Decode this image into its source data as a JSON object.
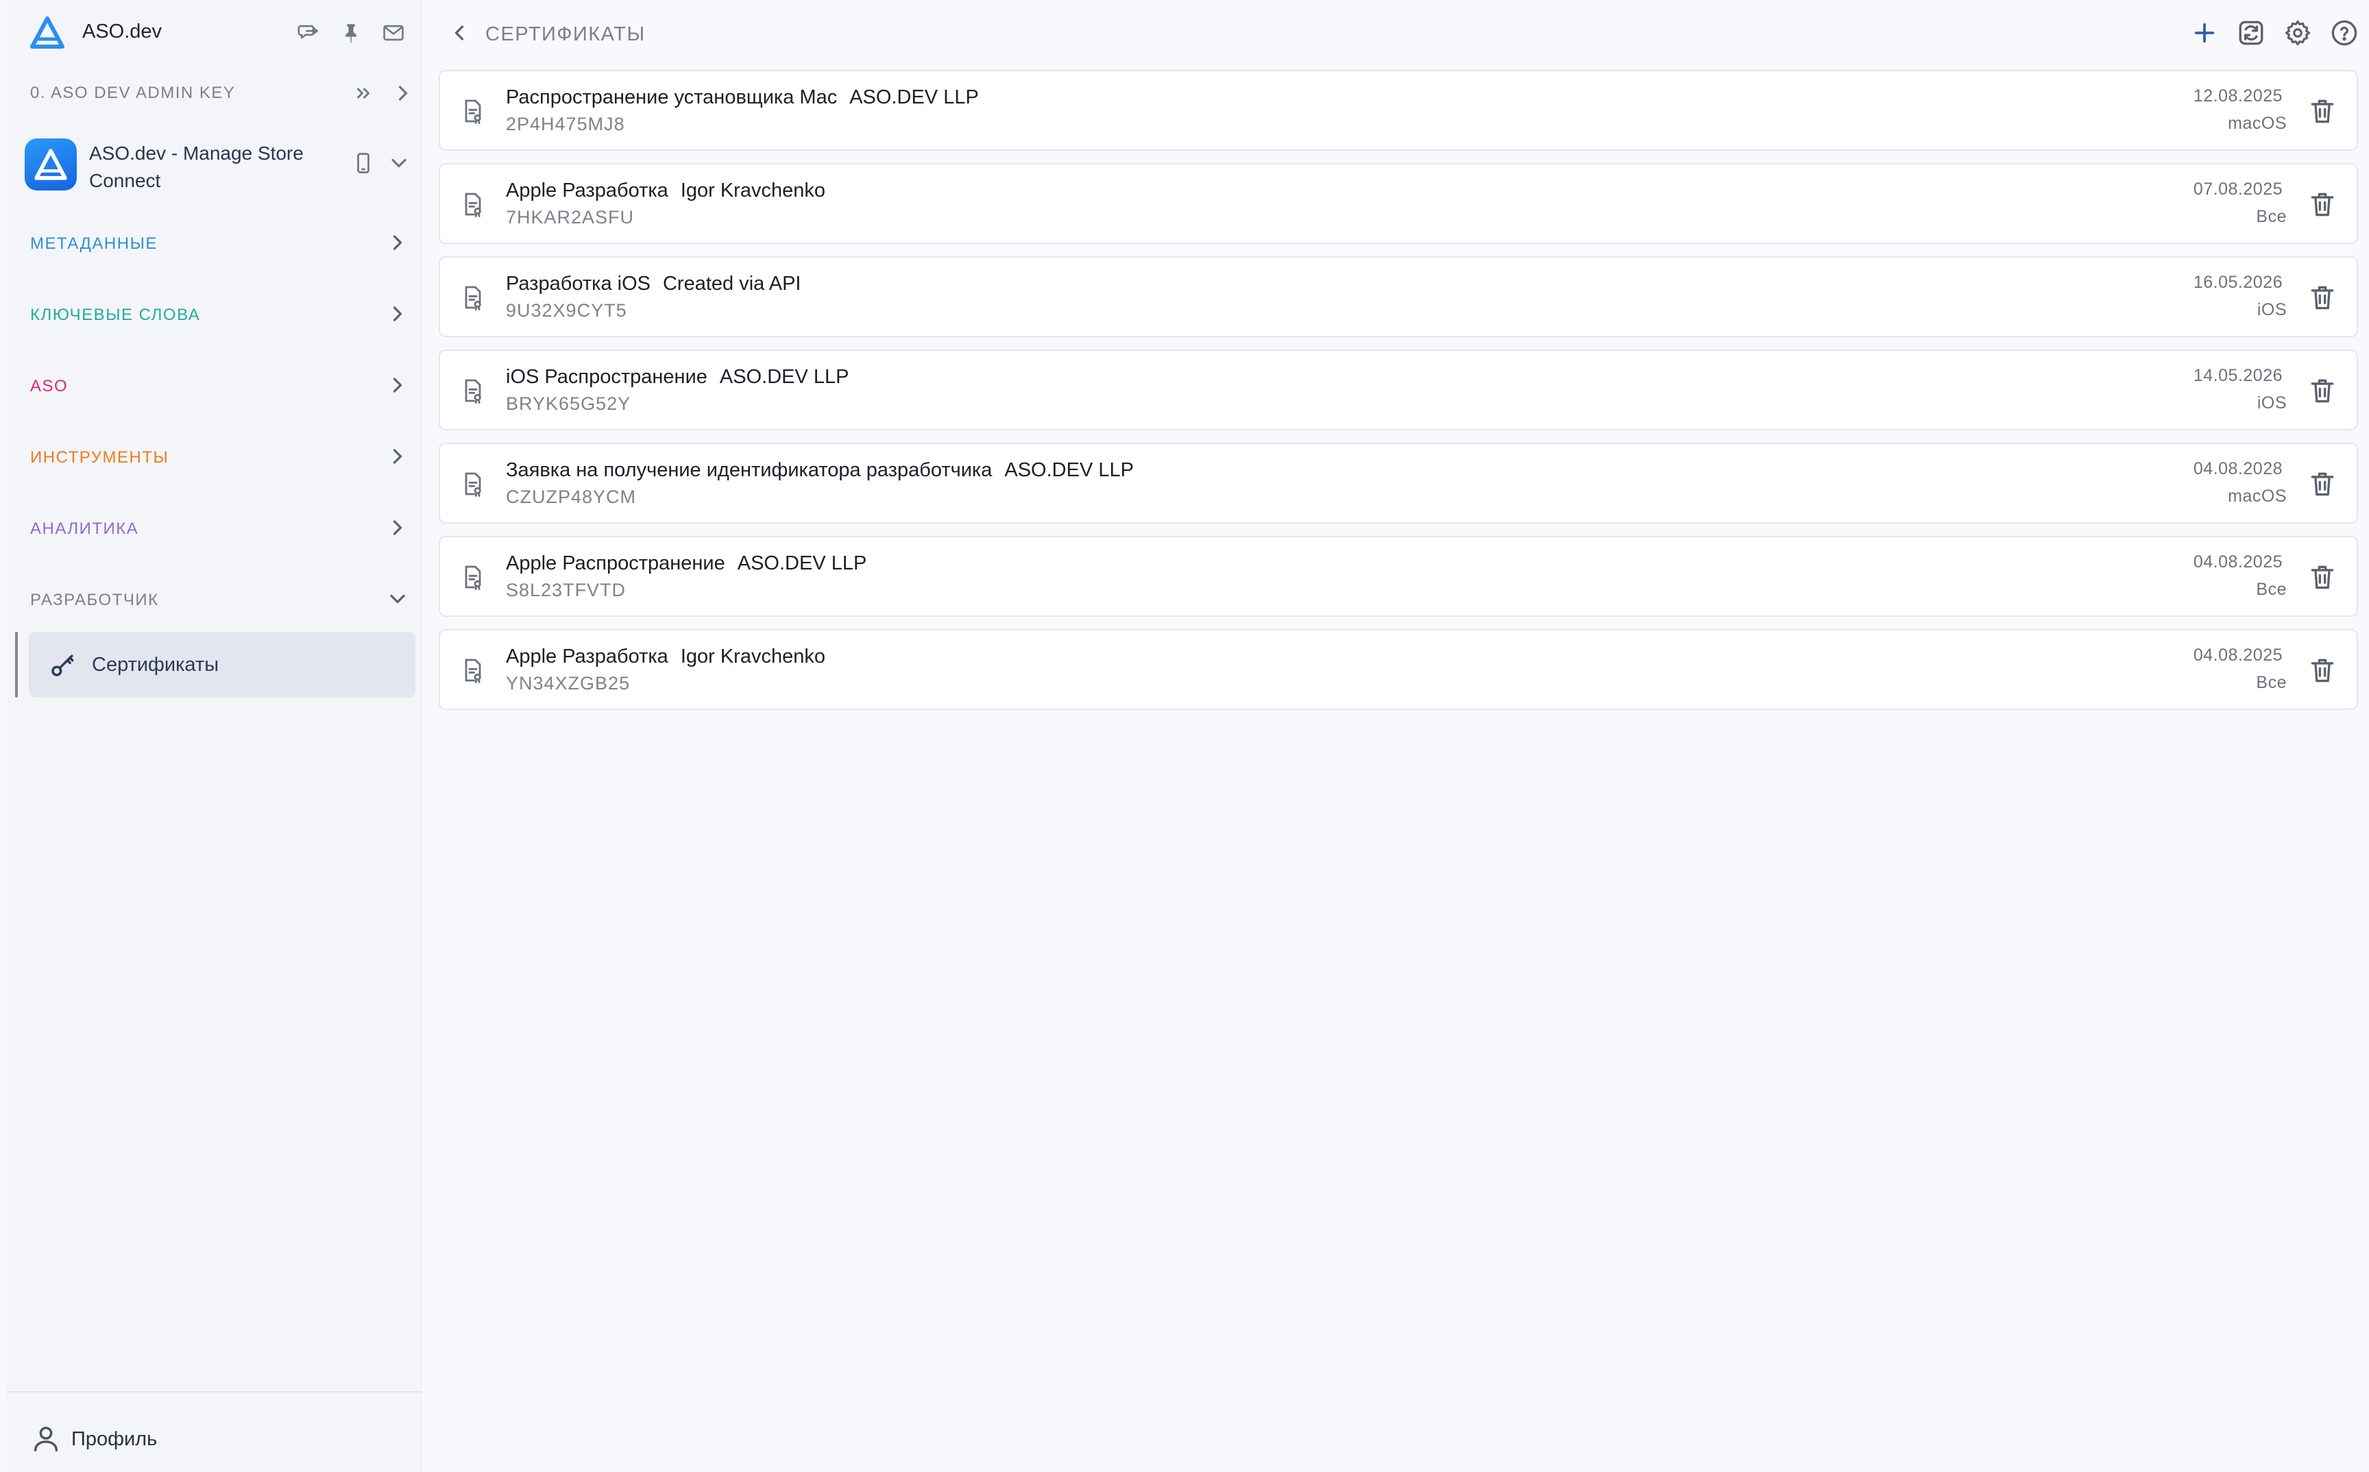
{
  "colors": {
    "metadata": "#2f8fd8",
    "keywords": "#1fae9c",
    "aso": "#e0257a",
    "tools": "#f07a1a",
    "analytics": "#8d6ad6",
    "developer": "#7a7f8b",
    "accent": "#2e5fa6"
  },
  "sidebar": {
    "app_name": "ASO.dev",
    "header_icons": [
      "message-icon",
      "pin-icon",
      "mail-icon"
    ],
    "key_label": "0. ASO DEV ADMIN KEY",
    "app": {
      "title": "ASO.dev - Manage Store Connect",
      "device_icon": "phone-icon"
    },
    "nav": [
      {
        "label": "МЕТАДАННЫЕ",
        "color": "#2f8fd8"
      },
      {
        "label": "КЛЮЧЕВЫЕ СЛОВА",
        "color": "#1fae9c"
      },
      {
        "label": "ASO",
        "color": "#e0257a"
      },
      {
        "label": "ИНСТРУМЕНТЫ",
        "color": "#f07a1a"
      },
      {
        "label": "АНАЛИТИКА",
        "color": "#8d6ad6"
      },
      {
        "label": "РАЗРАБОТЧИК",
        "color": "#7a7f8b"
      }
    ],
    "sub_item": {
      "label": "Сертификаты",
      "icon": "key-icon"
    },
    "profile": {
      "label": "Профиль",
      "icon": "user-icon"
    }
  },
  "topbar": {
    "title": "СЕРТИФИКАТЫ",
    "actions": [
      "add-icon",
      "refresh-icon",
      "settings-icon",
      "help-icon"
    ]
  },
  "certificates": [
    {
      "type": "Распространение установщика Mac",
      "owner": "ASO.DEV LLP",
      "serial": "2P4H475MJ8",
      "date": "12.08.2025",
      "platform": "macOS"
    },
    {
      "type": "Apple Разработка",
      "owner": "Igor Kravchenko",
      "serial": "7HKAR2ASFU",
      "date": "07.08.2025",
      "platform": "Все"
    },
    {
      "type": "Разработка iOS",
      "owner": "Created via API",
      "serial": "9U32X9CYT5",
      "date": "16.05.2026",
      "platform": "iOS"
    },
    {
      "type": "iOS Распространение",
      "owner": "ASO.DEV LLP",
      "serial": "BRYK65G52Y",
      "date": "14.05.2026",
      "platform": "iOS"
    },
    {
      "type": "Заявка на получение идентификатора разработчика",
      "owner": "ASO.DEV LLP",
      "serial": "CZUZP48YCM",
      "date": "04.08.2028",
      "platform": "macOS"
    },
    {
      "type": "Apple Распространение",
      "owner": "ASO.DEV LLP",
      "serial": "S8L23TFVTD",
      "date": "04.08.2025",
      "platform": "Все"
    },
    {
      "type": "Apple Разработка",
      "owner": "Igor Kravchenko",
      "serial": "YN34XZGB25",
      "date": "04.08.2025",
      "platform": "Все"
    }
  ]
}
